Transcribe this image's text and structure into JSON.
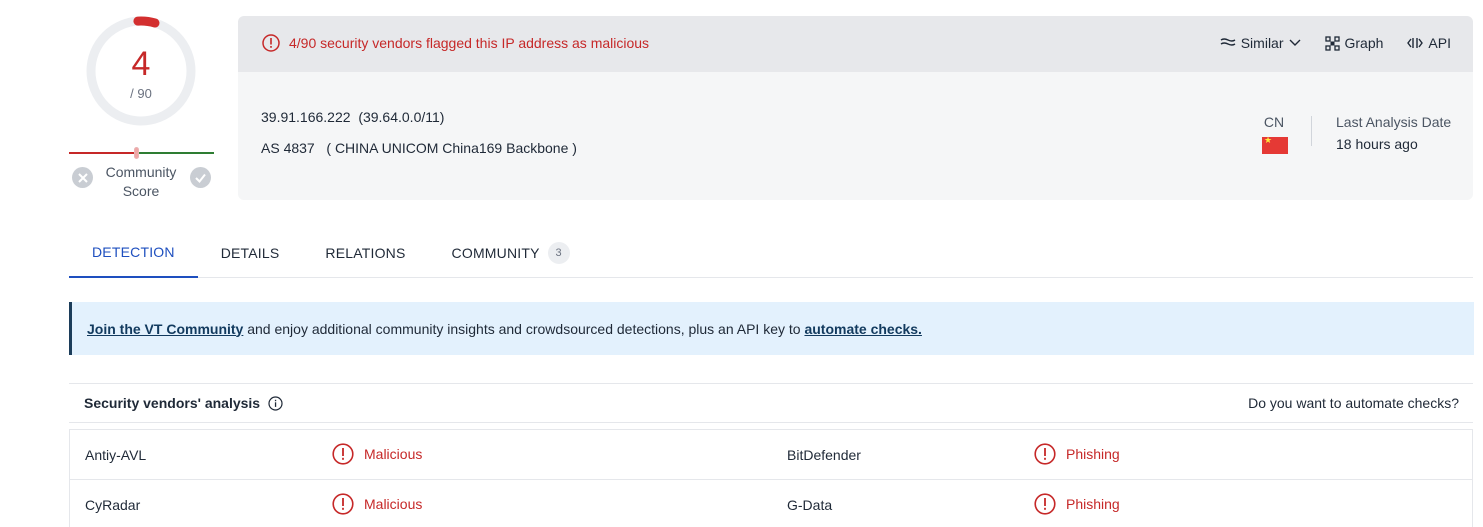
{
  "score": {
    "value": "4",
    "total": "/ 90",
    "community_label": "Community Score"
  },
  "alert": {
    "text": "4/90 security vendors flagged this IP address as malicious"
  },
  "tools": {
    "similar": "Similar",
    "graph": "Graph",
    "api": "API"
  },
  "ip_info": {
    "ip": "39.91.166.222",
    "range": "(39.64.0.0/11)",
    "as_number": "AS 4837",
    "as_owner": "( CHINA UNICOM China169 Backbone )",
    "country": "CN",
    "last_analysis_label": "Last Analysis Date",
    "last_analysis_value": "18 hours ago"
  },
  "tabs": [
    {
      "label": "DETECTION"
    },
    {
      "label": "DETAILS"
    },
    {
      "label": "RELATIONS"
    },
    {
      "label": "COMMUNITY",
      "badge": "3"
    }
  ],
  "banner": {
    "link_join": "Join the VT Community",
    "middle": " and enjoy additional community insights and crowdsourced detections, plus an API key to ",
    "link_automate": "automate checks."
  },
  "vendors": {
    "title": "Security vendors' analysis",
    "automate_prompt": "Do you want to automate checks?",
    "rows": [
      {
        "left_name": "Antiy-AVL",
        "left_verdict": "Malicious",
        "right_name": "BitDefender",
        "right_verdict": "Phishing"
      },
      {
        "left_name": "CyRadar",
        "left_verdict": "Malicious",
        "right_name": "G-Data",
        "right_verdict": "Phishing"
      }
    ]
  },
  "colors": {
    "malicious": "#c62828",
    "accent": "#1e4fbf",
    "banner_bg": "#e3f1fd"
  }
}
